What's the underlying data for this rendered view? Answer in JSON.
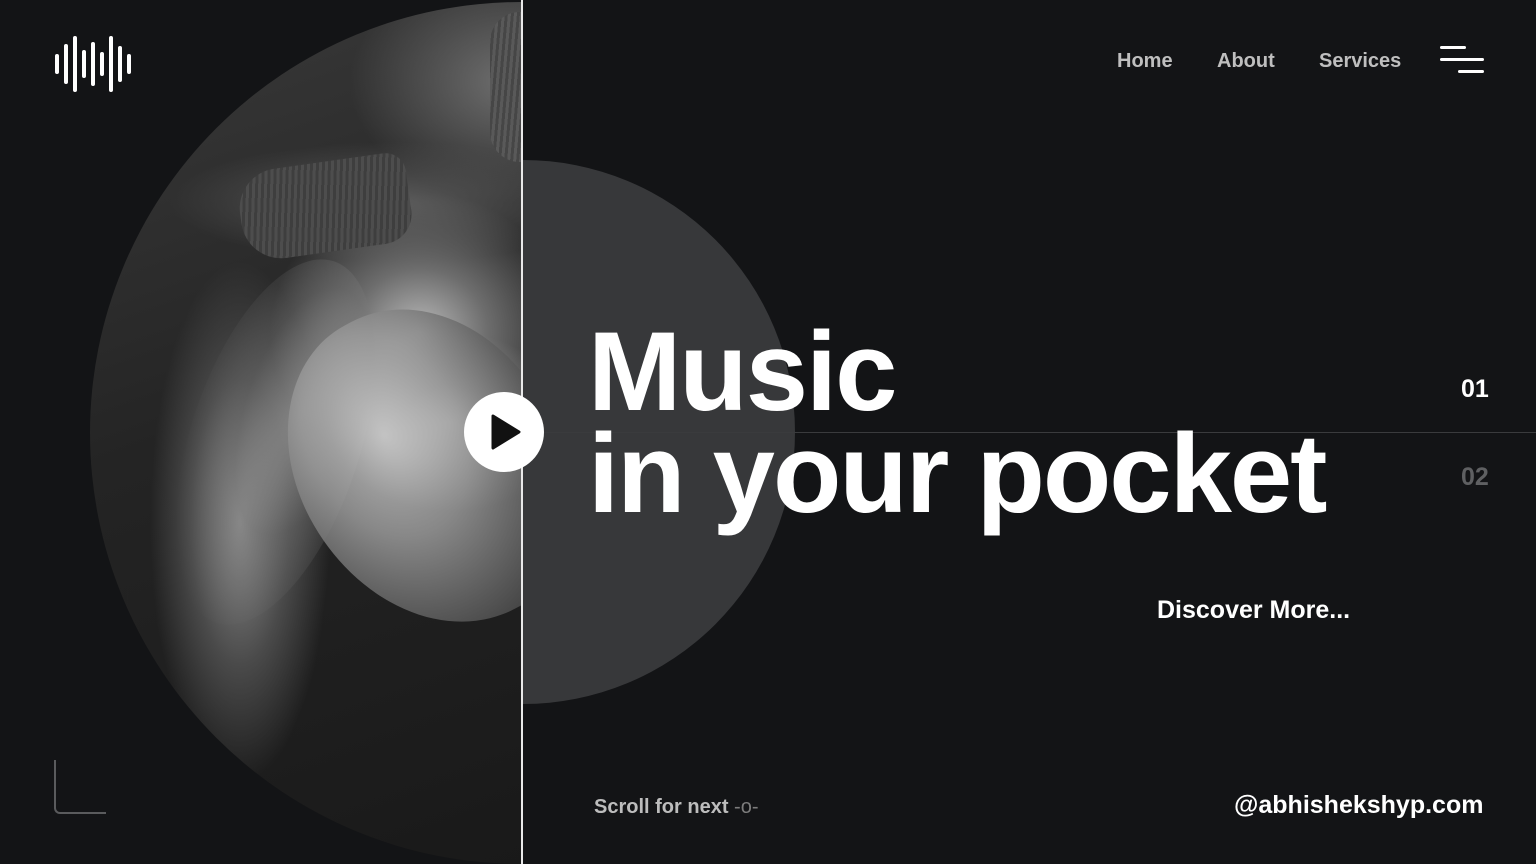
{
  "brand": {
    "logo_icon": "sound-wave-icon"
  },
  "nav": {
    "home": "Home",
    "about": "About",
    "services": "Services",
    "menu_icon": "hamburger-menu-icon"
  },
  "hero": {
    "line1": "Music",
    "line2": "in your pocket",
    "cta": "Discover More...",
    "play_icon": "play-icon",
    "photo": "black-and-white portrait of a woman with eyes closed"
  },
  "pager": {
    "first": "01",
    "second": "02"
  },
  "footer": {
    "scroll_text": "Scroll for next",
    "scroll_mark": "-o-",
    "handle": "@abhishekshyp.com"
  },
  "colors": {
    "background": "#131416",
    "half_circle": "#37383a",
    "accent": "#ffffff",
    "muted": "#5f6062"
  }
}
